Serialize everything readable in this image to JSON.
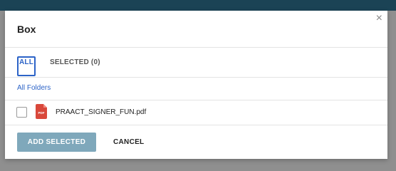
{
  "dialog": {
    "title": "Box",
    "close_glyph": "×"
  },
  "tabs": [
    {
      "label": "ALL",
      "active": true
    },
    {
      "label": "SELECTED (0)",
      "active": false
    }
  ],
  "breadcrumb": {
    "label": "All Folders"
  },
  "files": [
    {
      "name": "PRAACT_SIGNER_FUN.pdf",
      "checked": false,
      "icon": "pdf-file-icon",
      "icon_text": "PDF"
    }
  ],
  "footer": {
    "add_label": "ADD SELECTED",
    "cancel_label": "CANCEL"
  },
  "colors": {
    "accent": "#2c63c7",
    "pdf_red": "#d9483b",
    "add_button": "#7fa8bb",
    "top_bar": "#1b4355"
  }
}
